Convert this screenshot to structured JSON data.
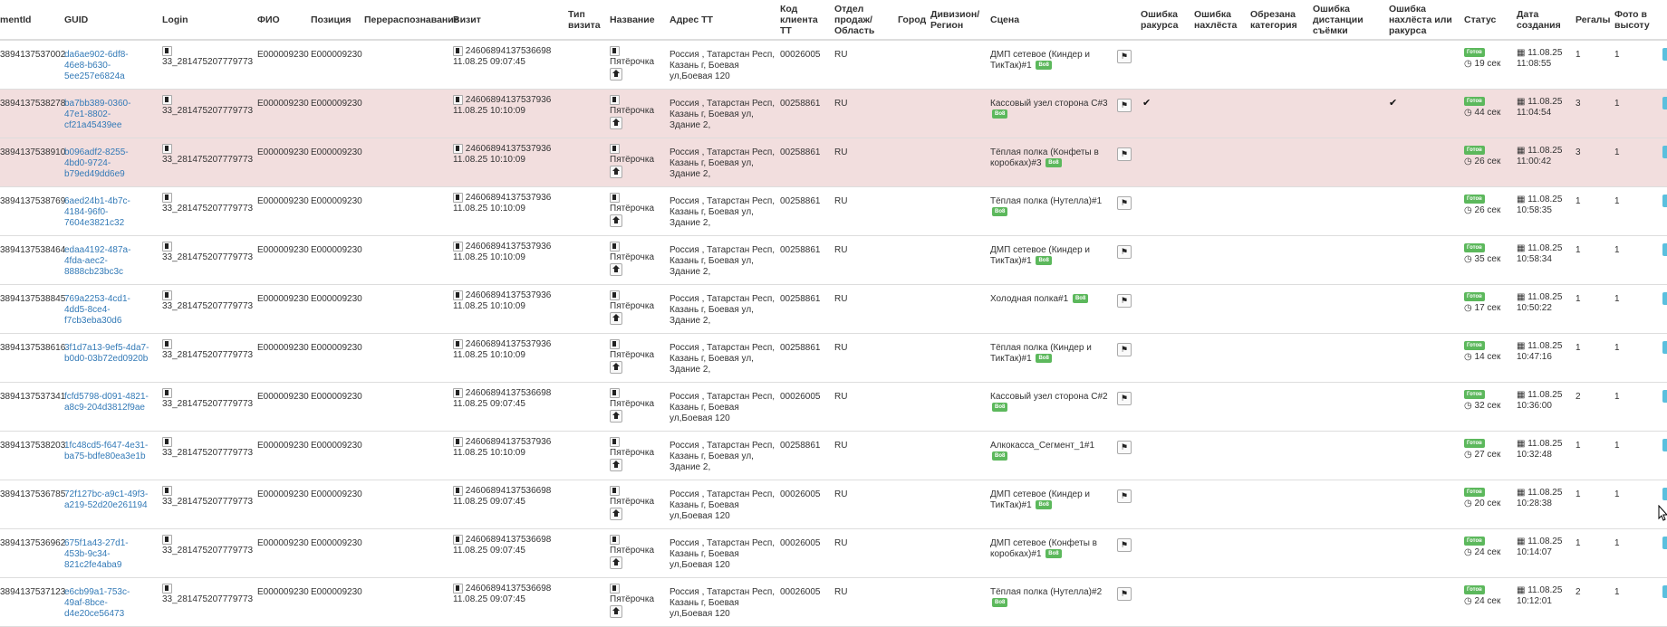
{
  "columns": [
    "mentId",
    "GUID",
    "Login",
    "ФИО",
    "Позиция",
    "Перераспознавание",
    "Визит",
    "Тип визита",
    "Название",
    "Адрес ТТ",
    "Код клиента ТТ",
    "Отдел продаж/ Область",
    "Город",
    "Дивизион/ Регион",
    "Сцена",
    "Ошибка ракурса",
    "Ошибка нахлёста",
    "Обрезана категория",
    "Ошибка дистанции съёмки",
    "Ошибка нахлёста или ракурса",
    "Статус",
    "Дата создания",
    "Регалы",
    "Фото в высоту"
  ],
  "icons": {
    "doc": "document-icon",
    "home": "home-icon",
    "flag": "flag-icon",
    "clock": "clock-icon",
    "calendar": "calendar-icon",
    "check": "checkmark-icon"
  },
  "colors": {
    "error_row": "#f2dede",
    "link": "#337ab7",
    "badge": "#5cb85c",
    "side_button": "#5bc0de"
  },
  "rows": [
    {
      "id": "3894137537002",
      "guid": "da6ae902-6df8-46e8-b630-5ee257e6824a",
      "login": "33_281475207779773",
      "fio": "E000009230",
      "position": "E000009230",
      "visit_num": "24606894137536698",
      "visit_date": "11.08.25 09:07:45",
      "name": "Пятёрочка",
      "address": "Россия , Татарстан Респ, Казань г, Боевая ул,Боевая 120",
      "code": "00026005",
      "sales": "RU",
      "scene": "ДМП сетевое (Киндер и ТикТак)#1",
      "badge": "Во8",
      "status": "Готов",
      "status_time": "19 сек",
      "date": "11.08.25",
      "time": "11:08:55",
      "regals": "1",
      "photo": "1",
      "err_rakurs": false,
      "err_mixed": false,
      "error": false
    },
    {
      "id": "3894137538278",
      "guid": "ba7bb389-0360-47e1-8802-cf21a45439ee",
      "login": "33_281475207779773",
      "fio": "E000009230",
      "position": "E000009230",
      "visit_num": "24606894137537936",
      "visit_date": "11.08.25 10:10:09",
      "name": "Пятёрочка",
      "address": "Россия , Татарстан Респ, Казань г, Боевая ул, Здание 2,",
      "code": "00258861",
      "sales": "RU",
      "scene": "Кассовый узел сторона С#3",
      "badge": "Во8",
      "status": "Готов",
      "status_time": "44 сек",
      "date": "11.08.25",
      "time": "11:04:54",
      "regals": "3",
      "photo": "1",
      "err_rakurs": true,
      "err_mixed": true,
      "error": true
    },
    {
      "id": "3894137538910",
      "guid": "b096adf2-8255-4bd0-9724-b79ed49dd6e9",
      "login": "33_281475207779773",
      "fio": "E000009230",
      "position": "E000009230",
      "visit_num": "24606894137537936",
      "visit_date": "11.08.25 10:10:09",
      "name": "Пятёрочка",
      "address": "Россия , Татарстан Респ, Казань г, Боевая ул, Здание 2,",
      "code": "00258861",
      "sales": "RU",
      "scene": "Тёплая полка (Конфеты в коробках)#3",
      "badge": "Во8",
      "status": "Готов",
      "status_time": "26 сек",
      "date": "11.08.25",
      "time": "11:00:42",
      "regals": "3",
      "photo": "1",
      "err_rakurs": false,
      "err_mixed": false,
      "error": true
    },
    {
      "id": "3894137538769",
      "guid": "6aed24b1-4b7c-4184-96f0-7604e3821c32",
      "login": "33_281475207779773",
      "fio": "E000009230",
      "position": "E000009230",
      "visit_num": "24606894137537936",
      "visit_date": "11.08.25 10:10:09",
      "name": "Пятёрочка",
      "address": "Россия , Татарстан Респ, Казань г, Боевая ул, Здание 2,",
      "code": "00258861",
      "sales": "RU",
      "scene": "Тёплая полка (Нутелла)#1",
      "badge": "Во8",
      "status": "Готов",
      "status_time": "26 сек",
      "date": "11.08.25",
      "time": "10:58:35",
      "regals": "1",
      "photo": "1",
      "err_rakurs": false,
      "err_mixed": false,
      "error": false
    },
    {
      "id": "3894137538464",
      "guid": "edaa4192-487a-4fda-aec2-8888cb23bc3c",
      "login": "33_281475207779773",
      "fio": "E000009230",
      "position": "E000009230",
      "visit_num": "24606894137537936",
      "visit_date": "11.08.25 10:10:09",
      "name": "Пятёрочка",
      "address": "Россия , Татарстан Респ, Казань г, Боевая ул, Здание 2,",
      "code": "00258861",
      "sales": "RU",
      "scene": "ДМП сетевое (Киндер и ТикТак)#1",
      "badge": "Во8",
      "status": "Готов",
      "status_time": "35 сек",
      "date": "11.08.25",
      "time": "10:58:34",
      "regals": "1",
      "photo": "1",
      "err_rakurs": false,
      "err_mixed": false,
      "error": false
    },
    {
      "id": "3894137538845",
      "guid": "769a2253-4cd1-4dd5-8ce4-f7cb3eba30d6",
      "login": "33_281475207779773",
      "fio": "E000009230",
      "position": "E000009230",
      "visit_num": "24606894137537936",
      "visit_date": "11.08.25 10:10:09",
      "name": "Пятёрочка",
      "address": "Россия , Татарстан Респ, Казань г, Боевая ул, Здание 2,",
      "code": "00258861",
      "sales": "RU",
      "scene": "Холодная полка#1",
      "badge": "Во8",
      "status": "Готов",
      "status_time": "17 сек",
      "date": "11.08.25",
      "time": "10:50:22",
      "regals": "1",
      "photo": "1",
      "err_rakurs": false,
      "err_mixed": false,
      "error": false
    },
    {
      "id": "3894137538616",
      "guid": "3f1d7a13-9ef5-4da7-b0d0-03b72ed0920b",
      "login": "33_281475207779773",
      "fio": "E000009230",
      "position": "E000009230",
      "visit_num": "24606894137537936",
      "visit_date": "11.08.25 10:10:09",
      "name": "Пятёрочка",
      "address": "Россия , Татарстан Респ, Казань г, Боевая ул, Здание 2,",
      "code": "00258861",
      "sales": "RU",
      "scene": "Тёплая полка (Киндер и ТикТак)#1",
      "badge": "Во8",
      "status": "Готов",
      "status_time": "14 сек",
      "date": "11.08.25",
      "time": "10:47:16",
      "regals": "1",
      "photo": "1",
      "err_rakurs": false,
      "err_mixed": false,
      "error": false
    },
    {
      "id": "3894137537341",
      "guid": "fcfd5798-d091-4821-a8c9-204d3812f9ae",
      "login": "33_281475207779773",
      "fio": "E000009230",
      "position": "E000009230",
      "visit_num": "24606894137536698",
      "visit_date": "11.08.25 09:07:45",
      "name": "Пятёрочка",
      "address": "Россия , Татарстан Респ, Казань г, Боевая ул,Боевая 120",
      "code": "00026005",
      "sales": "RU",
      "scene": "Кассовый узел сторона С#2",
      "badge": "Во8",
      "status": "Готов",
      "status_time": "32 сек",
      "date": "11.08.25",
      "time": "10:36:00",
      "regals": "2",
      "photo": "1",
      "err_rakurs": false,
      "err_mixed": false,
      "error": false
    },
    {
      "id": "3894137538203",
      "guid": "1fc48cd5-f647-4e31-ba75-bdfe80ea3e1b",
      "login": "33_281475207779773",
      "fio": "E000009230",
      "position": "E000009230",
      "visit_num": "24606894137537936",
      "visit_date": "11.08.25 10:10:09",
      "name": "Пятёрочка",
      "address": "Россия , Татарстан Респ, Казань г, Боевая ул, Здание 2,",
      "code": "00258861",
      "sales": "RU",
      "scene": "Алкокасса_Сегмент_1#1",
      "badge": "Во8",
      "status": "Готов",
      "status_time": "27 сек",
      "date": "11.08.25",
      "time": "10:32:48",
      "regals": "1",
      "photo": "1",
      "err_rakurs": false,
      "err_mixed": false,
      "error": false
    },
    {
      "id": "3894137536785",
      "guid": "72f127bc-a9c1-49f3-a219-52d20e261194",
      "login": "33_281475207779773",
      "fio": "E000009230",
      "position": "E000009230",
      "visit_num": "24606894137536698",
      "visit_date": "11.08.25 09:07:45",
      "name": "Пятёрочка",
      "address": "Россия , Татарстан Респ, Казань г, Боевая ул,Боевая 120",
      "code": "00026005",
      "sales": "RU",
      "scene": "ДМП сетевое (Киндер и ТикТак)#1",
      "badge": "Во8",
      "status": "Готов",
      "status_time": "20 сек",
      "date": "11.08.25",
      "time": "10:28:38",
      "regals": "1",
      "photo": "1",
      "err_rakurs": false,
      "err_mixed": false,
      "error": false
    },
    {
      "id": "3894137536962",
      "guid": "675f1a43-27d1-453b-9c34-821c2fe4aba9",
      "login": "33_281475207779773",
      "fio": "E000009230",
      "position": "E000009230",
      "visit_num": "24606894137536698",
      "visit_date": "11.08.25 09:07:45",
      "name": "Пятёрочка",
      "address": "Россия , Татарстан Респ, Казань г, Боевая ул,Боевая 120",
      "code": "00026005",
      "sales": "RU",
      "scene": "ДМП сетевое (Конфеты в коробках)#1",
      "badge": "Во8",
      "status": "Готов",
      "status_time": "24 сек",
      "date": "11.08.25",
      "time": "10:14:07",
      "regals": "1",
      "photo": "1",
      "err_rakurs": false,
      "err_mixed": false,
      "error": false
    },
    {
      "id": "3894137537123",
      "guid": "e6cb99a1-753c-49af-8bce-d4e20ce56473",
      "login": "33_281475207779773",
      "fio": "E000009230",
      "position": "E000009230",
      "visit_num": "24606894137536698",
      "visit_date": "11.08.25 09:07:45",
      "name": "Пятёрочка",
      "address": "Россия , Татарстан Респ, Казань г, Боевая ул,Боевая 120",
      "code": "00026005",
      "sales": "RU",
      "scene": "Тёплая полка (Нутелла)#2",
      "badge": "Во8",
      "status": "Готов",
      "status_time": "24 сек",
      "date": "11.08.25",
      "time": "10:12:01",
      "regals": "2",
      "photo": "1",
      "err_rakurs": false,
      "err_mixed": false,
      "error": false
    }
  ]
}
